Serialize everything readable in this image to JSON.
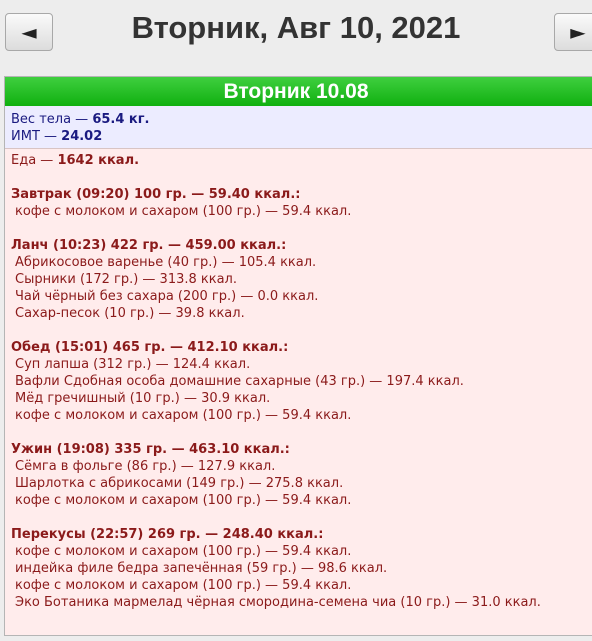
{
  "nav": {
    "prev_icon": "◄",
    "next_icon": "►"
  },
  "date_title": "Вторник, Авг 10, 2021",
  "day_header": "Вторник 10.08",
  "body": {
    "weight_label": "Вес тела — ",
    "weight_value": "65.4 кг.",
    "bmi_label": "ИМТ — ",
    "bmi_value": "24.02"
  },
  "food": {
    "total_label": "Еда — ",
    "total_value": "1642 ккал.",
    "meals": [
      {
        "header": "Завтрак (09:20) 100 гр. — 59.40 ккал.:",
        "items": [
          "кофе с молоком и сахаром (100 гр.) — 59.4 ккал."
        ]
      },
      {
        "header": "Ланч (10:23) 422 гр. — 459.00 ккал.:",
        "items": [
          "Абрикосовое варенье (40 гр.) — 105.4 ккал.",
          "Сырники (172 гр.) — 313.8 ккал.",
          "Чай чёрный без сахара (200 гр.) — 0.0 ккал.",
          "Сахар-песок (10 гр.) — 39.8 ккал."
        ]
      },
      {
        "header": "Обед (15:01) 465 гр. — 412.10 ккал.:",
        "items": [
          "Суп лапша (312 гр.) — 124.4 ккал.",
          "Вафли Сдобная особа домашние сахарные (43 гр.) — 197.4 ккал.",
          "Мёд гречишный (10 гр.) — 30.9 ккал.",
          "кофе с молоком и сахаром (100 гр.) — 59.4 ккал."
        ]
      },
      {
        "header": "Ужин (19:08) 335 гр. — 463.10 ккал.:",
        "items": [
          "Сёмга в фольге (86 гр.) — 127.9 ккал.",
          "Шарлотка с абрикосами (149 гр.) — 275.8 ккал.",
          "кофе с молоком и сахаром (100 гр.) — 59.4 ккал."
        ]
      },
      {
        "header": "Перекусы (22:57) 269 гр. — 248.40 ккал.:",
        "items": [
          "кофе с молоком и сахаром (100 гр.) — 59.4 ккал.",
          "индейка филе бедра запечённая (59 гр.) — 98.6 ккал.",
          "кофе с молоком и сахаром (100 гр.) — 59.4 ккал.",
          "Эко Ботаника мармелад чёрная смородина-семена чиа (10 гр.) — 31.0 ккал."
        ]
      }
    ]
  }
}
